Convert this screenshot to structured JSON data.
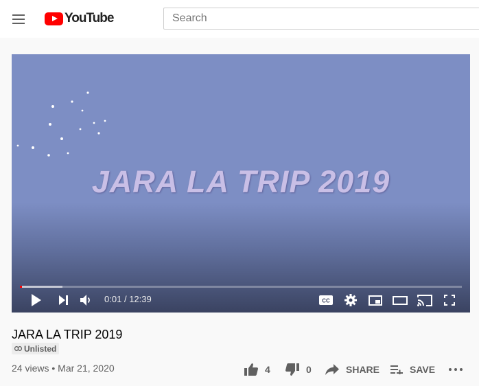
{
  "header": {
    "logo_text": "YouTube",
    "search_placeholder": "Search"
  },
  "player": {
    "overlay_title": "JARA LA TRIP 2019",
    "time_current": "0:01",
    "time_separator": "/",
    "time_total": "12:39",
    "progress_played": 0.0013,
    "progress_buffered": 0.097,
    "background_color": "#7d8ec4",
    "accent_color": "#ff0000"
  },
  "video": {
    "title": "JARA LA TRIP 2019",
    "visibility": "Unlisted",
    "views": "24 views",
    "dot": "•",
    "date": "Mar 21, 2020",
    "likes": "4",
    "dislikes": "0",
    "share_label": "SHARE",
    "save_label": "SAVE"
  }
}
